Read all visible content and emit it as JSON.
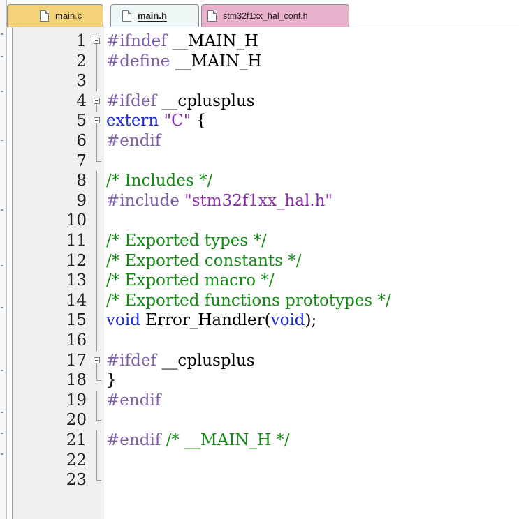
{
  "tabs": [
    {
      "label": "main.c",
      "active": false,
      "color": "#f4d277"
    },
    {
      "label": "main.h",
      "active": true,
      "color": "#f0f7f7"
    },
    {
      "label": "stm32f1xx_hal_conf.h",
      "active": false,
      "color": "#eab1cc"
    }
  ],
  "editor": {
    "lines": [
      {
        "n": "1",
        "fold": "open",
        "tokens": [
          [
            "pre",
            "#ifndef "
          ],
          [
            "txt",
            "__MAIN_H"
          ]
        ]
      },
      {
        "n": "2",
        "fold": "line",
        "tokens": [
          [
            "pre",
            "#define "
          ],
          [
            "txt",
            "__MAIN_H"
          ]
        ]
      },
      {
        "n": "3",
        "fold": "line",
        "tokens": []
      },
      {
        "n": "4",
        "fold": "open",
        "tokens": [
          [
            "pre",
            "#ifdef "
          ],
          [
            "txt",
            "__cplusplus"
          ]
        ]
      },
      {
        "n": "5",
        "fold": "open",
        "tokens": [
          [
            "blue",
            "extern "
          ],
          [
            "str",
            "\"C\""
          ],
          [
            "txt",
            " {"
          ]
        ]
      },
      {
        "n": "6",
        "fold": "line",
        "tokens": [
          [
            "pre",
            "#endif"
          ]
        ]
      },
      {
        "n": "7",
        "fold": "end",
        "tokens": []
      },
      {
        "n": "8",
        "fold": "line",
        "tokens": [
          [
            "com",
            "/* Includes */"
          ]
        ]
      },
      {
        "n": "9",
        "fold": "line",
        "tokens": [
          [
            "pre",
            "#include "
          ],
          [
            "str",
            "\"stm32f1xx_hal.h\""
          ]
        ]
      },
      {
        "n": "10",
        "fold": "line",
        "tokens": []
      },
      {
        "n": "11",
        "fold": "line",
        "tokens": [
          [
            "com",
            "/* Exported types */"
          ]
        ]
      },
      {
        "n": "12",
        "fold": "line",
        "tokens": [
          [
            "com",
            "/* Exported constants */"
          ]
        ]
      },
      {
        "n": "13",
        "fold": "line",
        "tokens": [
          [
            "com",
            "/* Exported macro */"
          ]
        ]
      },
      {
        "n": "14",
        "fold": "line",
        "tokens": [
          [
            "com",
            "/* Exported functions prototypes */"
          ]
        ]
      },
      {
        "n": "15",
        "fold": "line",
        "tokens": [
          [
            "blue",
            "void "
          ],
          [
            "txt",
            "Error_Handler("
          ],
          [
            "blue",
            "void"
          ],
          [
            "txt",
            ");"
          ]
        ]
      },
      {
        "n": "16",
        "fold": "line",
        "tokens": []
      },
      {
        "n": "17",
        "fold": "open",
        "tokens": [
          [
            "pre",
            "#ifdef "
          ],
          [
            "txt",
            "__cplusplus"
          ]
        ]
      },
      {
        "n": "18",
        "fold": "end",
        "tokens": [
          [
            "txt",
            "}"
          ]
        ]
      },
      {
        "n": "19",
        "fold": "line",
        "tokens": [
          [
            "pre",
            "#endif"
          ]
        ]
      },
      {
        "n": "20",
        "fold": "end",
        "tokens": []
      },
      {
        "n": "21",
        "fold": "line",
        "tokens": [
          [
            "pre",
            "#endif "
          ],
          [
            "com",
            "/* __MAIN_H */"
          ]
        ]
      },
      {
        "n": "22",
        "fold": "line",
        "tokens": []
      },
      {
        "n": "23",
        "fold": "last",
        "tokens": []
      }
    ]
  },
  "colors": {
    "preprocessor": "#7f5fa8",
    "keyword": "#1c2cd0",
    "string": "#8a2bb0",
    "comment": "#138a13"
  }
}
